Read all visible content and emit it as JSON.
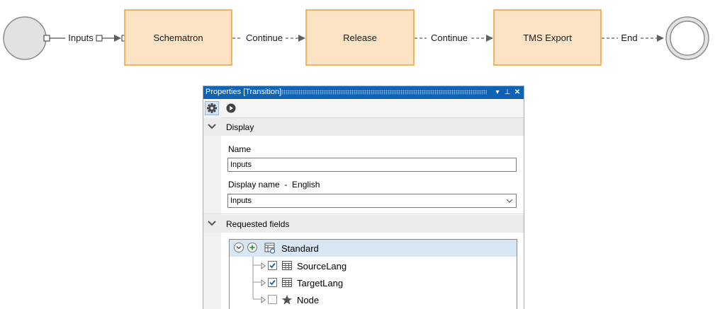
{
  "diagram": {
    "nodes": [
      {
        "id": "start",
        "type": "start-event"
      },
      {
        "id": "schematron",
        "type": "task",
        "label": "Schematron"
      },
      {
        "id": "release",
        "type": "task",
        "label": "Release"
      },
      {
        "id": "tms_export",
        "type": "task",
        "label": "TMS Export"
      },
      {
        "id": "end",
        "type": "end-event"
      }
    ],
    "edges": [
      {
        "from": "start",
        "to": "schematron",
        "label": "Inputs",
        "style": "solid",
        "selected": true
      },
      {
        "from": "schematron",
        "to": "release",
        "label": "Continue",
        "style": "dashed"
      },
      {
        "from": "release",
        "to": "tms_export",
        "label": "Continue",
        "style": "dashed"
      },
      {
        "from": "tms_export",
        "to": "end",
        "label": "End",
        "style": "dashed"
      }
    ],
    "colors": {
      "task_fill": "#fde3c6",
      "task_border": "#f0a030",
      "event_fill": "#e2e2e2",
      "event_border": "#8c8c8c"
    }
  },
  "panel": {
    "title": "Properties [Transition]",
    "title_buttons": [
      {
        "name": "dropdown-icon",
        "glyph": "▾"
      },
      {
        "name": "pin-icon",
        "glyph": "⊥"
      },
      {
        "name": "close-icon",
        "glyph": "✕"
      }
    ],
    "toolbar": [
      {
        "name": "gear-icon",
        "selected": true
      },
      {
        "name": "play-icon",
        "selected": false
      }
    ],
    "sections": {
      "display": {
        "title": "Display",
        "name_label": "Name",
        "name_value": "Inputs",
        "display_name_label": "Display name  -  English",
        "display_name_value": "Inputs"
      },
      "requested_fields": {
        "title": "Requested fields",
        "tree": {
          "root": {
            "label": "Standard",
            "icon": "table-link-icon"
          },
          "items": [
            {
              "label": "SourceLang",
              "checked": true,
              "icon": "table-icon"
            },
            {
              "label": "TargetLang",
              "checked": true,
              "icon": "table-icon"
            },
            {
              "label": "Node",
              "checked": false,
              "icon": "star-icon"
            }
          ]
        }
      }
    },
    "colors": {
      "titlebar": "#0e63b5",
      "selected_row": "#d8e6f3",
      "check": "#1f5fa8"
    }
  }
}
